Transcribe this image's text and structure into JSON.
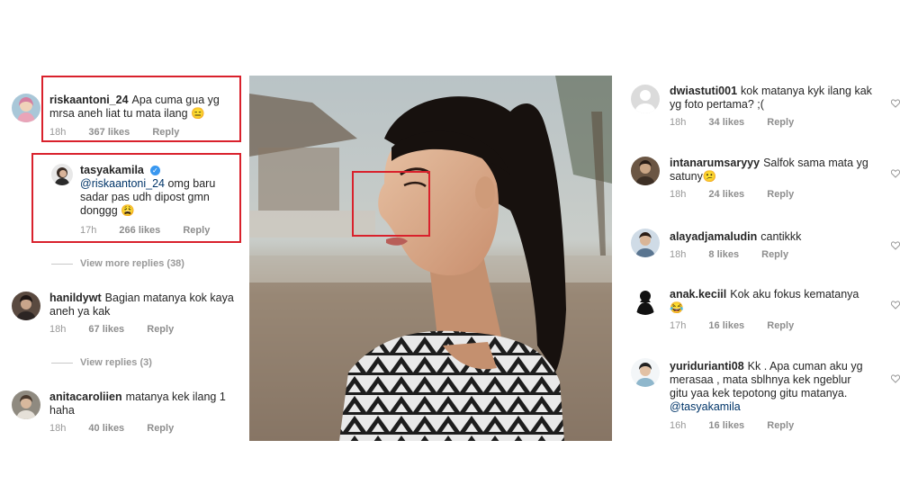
{
  "left_comments": [
    {
      "username": "riskaantoni_24",
      "text": "Apa cuma gua yg mrsa aneh liat tu mata ilang",
      "emoji": "😑",
      "time": "18h",
      "likes": "367 likes",
      "reply": "Reply"
    },
    {
      "username": "tasyakamila",
      "mention": "@riskaantoni_24",
      "text": " omg baru sadar pas udh dipost gmn donggg",
      "emoji": "😩",
      "time": "17h",
      "likes": "266 likes",
      "reply": "Reply"
    },
    {
      "username": "hanildywt",
      "text": "Bagian matanya kok kaya aneh ya kak",
      "time": "18h",
      "likes": "67 likes",
      "reply": "Reply"
    },
    {
      "username": "anitacaroliien",
      "text": "matanya kek ilang 1 haha",
      "time": "18h",
      "likes": "40 likes",
      "reply": "Reply"
    }
  ],
  "thread_toggles": {
    "more_replies": "View more replies (38)",
    "view_replies": "View replies (3)"
  },
  "right_comments": [
    {
      "username": "dwiastuti001",
      "text": "kok matanya kyk ilang kak yg foto pertama? ;(",
      "time": "18h",
      "likes": "34 likes",
      "reply": "Reply"
    },
    {
      "username": "intanarumsaryyy",
      "text": "Salfok sama mata yg satuny",
      "emoji": "😕",
      "time": "18h",
      "likes": "24 likes",
      "reply": "Reply"
    },
    {
      "username": "alayadjamaludin",
      "text": "cantikkk",
      "time": "18h",
      "likes": "8 likes",
      "reply": "Reply"
    },
    {
      "username": "anak.keciil",
      "text": "Kok aku fokus kematanya",
      "emoji": "😂",
      "time": "17h",
      "likes": "16 likes",
      "reply": "Reply"
    },
    {
      "username": "yuridurianti08",
      "text": "Kk . Apa cuman aku yg merasaa , mata sblhnya kek ngeblur gitu yaa kek tepotong gitu matanya.",
      "mention": "@tasyakamila",
      "time": "16h",
      "likes": "16 likes",
      "reply": "Reply"
    }
  ],
  "colors": {
    "highlight_box": "#d9212c",
    "verified_badge": "#3897f0",
    "meta_text": "#999999"
  },
  "icons": {
    "verified": "verified-badge-icon",
    "like": "heart-icon"
  }
}
